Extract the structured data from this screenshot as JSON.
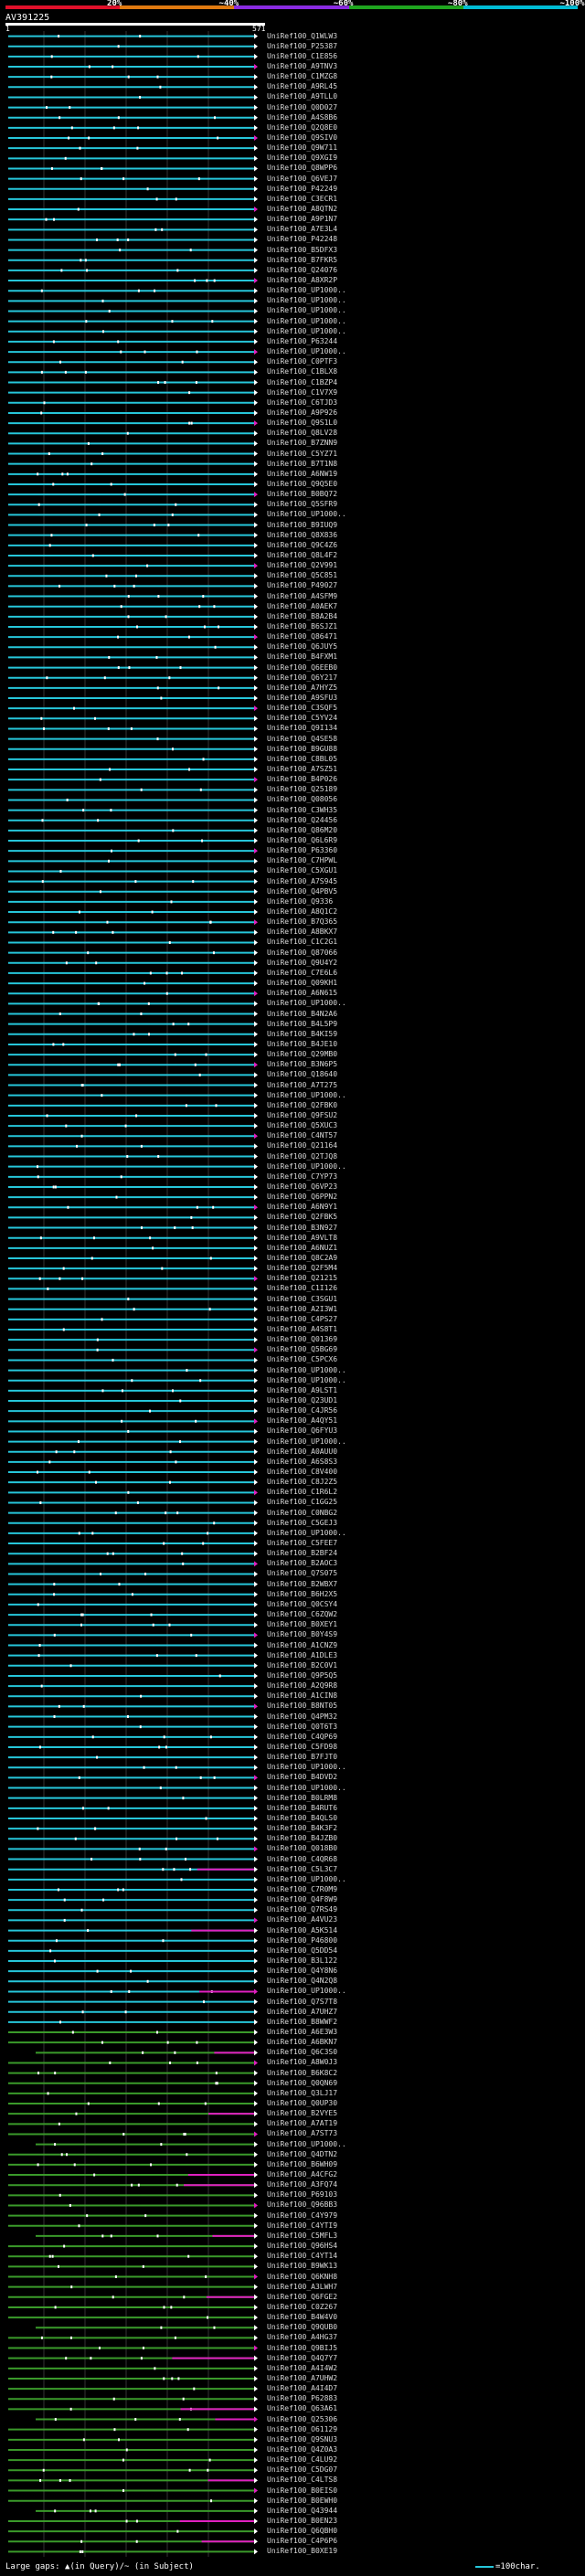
{
  "scale": {
    "labels": [
      "20%",
      "~40%",
      "~60%",
      "~80%",
      "~100%"
    ],
    "colors": [
      "#e0102a",
      "#e07a10",
      "#8a2be2",
      "#1fa51f",
      "#00bcd4"
    ]
  },
  "query": {
    "name": "AV391225",
    "start": "1",
    "end": "571"
  },
  "legend": {
    "text": "Large gaps: ▲(in Query)/~ (in Subject)",
    "scale_text": "=100char."
  },
  "colors": {
    "cyan": "#26c6da",
    "green": "#3a9a2a",
    "magenta": "#e020c0",
    "white": "#ffffff"
  },
  "hits": [
    "UniRef100_Q1WLW3",
    "UniRef100_P25387",
    "UniRef100_C1E856",
    "UniRef100_A9TNV3",
    "UniRef100_C1MZG8",
    "UniRef100_A9RL45",
    "UniRef100_A9TLL0",
    "UniRef100_Q0D027",
    "UniRef100_A4S8B6",
    "UniRef100_Q2Q8E0",
    "UniRef100_Q9SIV0",
    "UniRef100_Q9W711",
    "UniRef100_Q9XGI9",
    "UniRef100_Q8WPP6",
    "UniRef100_Q6VEJ7",
    "UniRef100_P42249",
    "UniRef100_C3ECR1",
    "UniRef100_A8QTN2",
    "UniRef100_A9P1N7",
    "UniRef100_A7E3L4",
    "UniRef100_P42248",
    "UniRef100_B5DFX3",
    "UniRef100_B7FKR5",
    "UniRef100_Q24076",
    "UniRef100_A8XR2P",
    "UniRef100_UP1000..",
    "UniRef100_UP1000..",
    "UniRef100_UP1000..",
    "UniRef100_UP1000..",
    "UniRef100_UP1000..",
    "UniRef100_P63244",
    "UniRef100_UP1000..",
    "UniRef100_C0PTF3",
    "UniRef100_C1BLX8",
    "UniRef100_C1BZP4",
    "UniRef100_C1V7X9",
    "UniRef100_C6TJD3",
    "UniRef100_A9P926",
    "UniRef100_Q9S1L0",
    "UniRef100_Q8LV28",
    "UniRef100_B7ZNN9",
    "UniRef100_C5YZ71",
    "UniRef100_B7T1N8",
    "UniRef100_A6NW19",
    "UniRef100_Q9Q5E0",
    "UniRef100_B0BQ72",
    "UniRef100_Q5SFR9",
    "UniRef100_UP1000..",
    "UniRef100_B9IUQ9",
    "UniRef100_Q8X836",
    "UniRef100_Q9C4Z6",
    "UniRef100_Q8L4F2",
    "UniRef100_Q2V991",
    "UniRef100_Q5C851",
    "UniRef100_P49027",
    "UniRef100_A4SFM9",
    "UniRef100_A0AEK7",
    "UniRef100_B8A2B4",
    "UniRef100_B6SJZ1",
    "UniRef100_Q86471",
    "UniRef100_Q6JUY5",
    "UniRef100_B4FXM1",
    "UniRef100_Q6EEB0",
    "UniRef100_Q6Y217",
    "UniRef100_A7HYZ5",
    "UniRef100_A9SFU3",
    "UniRef100_C3SQF5",
    "UniRef100_C5YV24",
    "UniRef100_Q9I134",
    "UniRef100_Q4SE58",
    "UniRef100_B9GU88",
    "UniRef100_C8BL05",
    "UniRef100_A7SZ51",
    "UniRef100_B4P026",
    "UniRef100_Q25189",
    "UniRef100_Q08056",
    "UniRef100_C3WH35",
    "UniRef100_Q24456",
    "UniRef100_Q86M20",
    "UniRef100_Q6L6R9",
    "UniRef100_P63360",
    "UniRef100_C7HPWL",
    "UniRef100_C5XGU1",
    "UniRef100_A7S945",
    "UniRef100_Q4PBV5",
    "UniRef100_Q9336",
    "UniRef100_A8Q1C2",
    "UniRef100_B7Q365",
    "UniRef100_A8BKX7",
    "UniRef100_C1C2G1",
    "UniRef100_Q87066",
    "UniRef100_Q9U4Y2",
    "UniRef100_C7E6L6",
    "UniRef100_Q09KH1",
    "UniRef100_A6N615",
    "UniRef100_UP1000..",
    "UniRef100_B4N2A6",
    "UniRef100_B4L5P9",
    "UniRef100_B4KI59",
    "UniRef100_B4JE10",
    "UniRef100_Q29MB0",
    "UniRef100_B3N6P5",
    "UniRef100_Q18640",
    "UniRef100_A7T275",
    "UniRef100_UP1000..",
    "UniRef100_Q2FBK0",
    "UniRef100_Q9FSU2",
    "UniRef100_Q5XUC3",
    "UniRef100_C4NT57",
    "UniRef100_Q21164",
    "UniRef100_Q2TJQ8",
    "UniRef100_UP1000..",
    "UniRef100_C7YP73",
    "UniRef100_Q6VP23",
    "UniRef100_Q6PPN2",
    "UniRef100_A6N9Y1",
    "UniRef100_Q2FBK5",
    "UniRef100_B3N927",
    "UniRef100_A9VLT8",
    "UniRef100_A6NUZ1",
    "UniRef100_Q8C2A9",
    "UniRef100_Q2F5M4",
    "UniRef100_Q21215",
    "UniRef100_C1I126",
    "UniRef100_C3SGU1",
    "UniRef100_A2I3W1",
    "UniRef100_C4PS27",
    "UniRef100_A4S8T1",
    "UniRef100_Q01369",
    "UniRef100_Q5BG69",
    "UniRef100_C5PCX6",
    "UniRef100_UP1000..",
    "UniRef100_UP1000..",
    "UniRef100_A9LST1",
    "UniRef100_Q23UD1",
    "UniRef100_C4JR56",
    "UniRef100_A4QY51",
    "UniRef100_Q6FYU3",
    "UniRef100_UP1000..",
    "UniRef100_A0AUU0",
    "UniRef100_A6S8S3",
    "UniRef100_C8V400",
    "UniRef100_C8J2Z5",
    "UniRef100_C1R6L2",
    "UniRef100_C1GG25",
    "UniRef100_C0NBG2",
    "UniRef100_C5GEJ3",
    "UniRef100_UP1000..",
    "UniRef100_C5FEE7",
    "UniRef100_B2BF24",
    "UniRef100_B2AOC3",
    "UniRef100_Q7S075",
    "UniRef100_B2WBX7",
    "UniRef100_B6H2X5",
    "UniRef100_Q0CSY4",
    "UniRef100_C6ZQW2",
    "UniRef100_B0XEY1",
    "UniRef100_B0Y4S9",
    "UniRef100_A1CNZ9",
    "UniRef100_A1DLE3",
    "UniRef100_B2C0V1",
    "UniRef100_Q9P5Q5",
    "UniRef100_A2Q9R8",
    "UniRef100_A1CIN8",
    "UniRef100_B8NT05",
    "UniRef100_Q4PM32",
    "UniRef100_Q0T6T3",
    "UniRef100_C4QP69",
    "UniRef100_C5FD98",
    "UniRef100_B7FJT0",
    "UniRef100_UP1000..",
    "UniRef100_B4DVD2",
    "UniRef100_UP1000..",
    "UniRef100_B0LRM8",
    "UniRef100_B4RUT6",
    "UniRef100_B4QLS0",
    "UniRef100_B4K3F2",
    "UniRef100_B4JZB0",
    "UniRef100_Q018B0",
    "UniRef100_C4QR68",
    "UniRef100_C5L3C7",
    "UniRef100_UP1000..",
    "UniRef100_C7R0M9",
    "UniRef100_Q4F8W9",
    "UniRef100_Q7RS49",
    "UniRef100_A4VU23",
    "UniRef100_A5K514",
    "UniRef100_P46800",
    "UniRef100_Q5DD54",
    "UniRef100_B3L122",
    "UniRef100_Q4Y8N6",
    "UniRef100_Q4N2Q8",
    "UniRef100_UP1000..",
    "UniRef100_Q7S7T8",
    "UniRef100_A7UHZ7",
    "UniRef100_B8WWF2",
    "UniRef100_A6E3W3",
    "UniRef100_A6BKN7",
    "UniRef100_Q6C3S0",
    "UniRef100_A8W0J3",
    "UniRef100_B6K8C2",
    "UniRef100_Q0QN69",
    "UniRef100_Q3LJ17",
    "UniRef100_Q0UP30",
    "UniRef100_B2VYE5",
    "UniRef100_A7AT19",
    "UniRef100_A7ST73",
    "UniRef100_UP1000..",
    "UniRef100_Q4DTN2",
    "UniRef100_B6WH09",
    "UniRef100_A4CFG2",
    "UniRef100_A3FQ74",
    "UniRef100_P69103",
    "UniRef100_Q96BB3",
    "UniRef100_C4Y979",
    "UniRef100_C4YTI9",
    "UniRef100_C5MFL3",
    "UniRef100_Q96HS4",
    "UniRef100_C4YT14",
    "UniRef100_B9WK13",
    "UniRef100_Q6KNH8",
    "UniRef100_A3LWH7",
    "UniRef100_Q6FGE2",
    "UniRef100_C0Z267",
    "UniRef100_B4W4V0",
    "UniRef100_Q9QUB0",
    "UniRef100_A4HG37",
    "UniRef100_Q9BIJ5",
    "UniRef100_Q4Q7Y7",
    "UniRef100_A4I4W2",
    "UniRef100_A7UHW2",
    "UniRef100_A4I4D7",
    "UniRef100_P62883",
    "UniRef100_Q63A61",
    "UniRef100_Q25306",
    "UniRef100_O61129",
    "UniRef100_Q9SNU3",
    "UniRef100_Q4Z0A3",
    "UniRef100_C4LU92",
    "UniRef100_C5DG07",
    "UniRef100_C4LTS8",
    "UniRef100_B0EIS0",
    "UniRef100_B0EWH0",
    "UniRef100_Q43944",
    "UniRef100_B0EN23",
    "UniRef100_Q6QBH0",
    "UniRef100_C4P6P6",
    "UniRef100_B0XE19"
  ]
}
